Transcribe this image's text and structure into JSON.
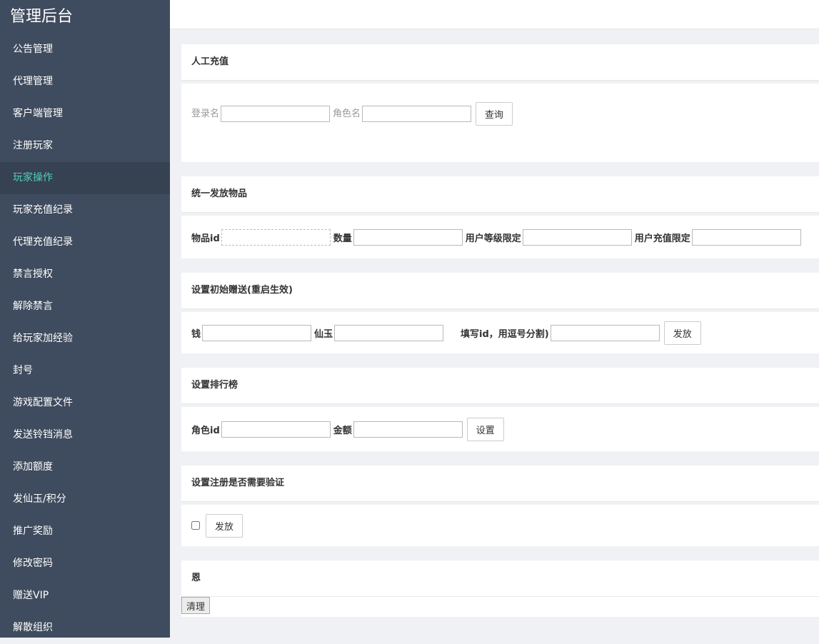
{
  "app": {
    "title": "管理后台"
  },
  "sidebar": {
    "items": [
      {
        "label": "公告管理"
      },
      {
        "label": "代理管理"
      },
      {
        "label": "客户端管理"
      },
      {
        "label": "注册玩家"
      },
      {
        "label": "玩家操作",
        "active": true
      },
      {
        "label": "玩家充值纪录"
      },
      {
        "label": "代理充值纪录"
      },
      {
        "label": "禁言授权"
      },
      {
        "label": "解除禁言"
      },
      {
        "label": "给玩家加经验"
      },
      {
        "label": "封号"
      },
      {
        "label": "游戏配置文件"
      },
      {
        "label": "发送铃铛消息"
      },
      {
        "label": "添加额度"
      },
      {
        "label": "发仙玉/积分"
      },
      {
        "label": "推广奖励"
      },
      {
        "label": "修改密码"
      },
      {
        "label": "赠送VIP"
      },
      {
        "label": "解散组织"
      }
    ]
  },
  "colors": {
    "sidebar_bg": "#3f4b5e",
    "active_bg": "#364152",
    "active_text": "#4fd1b4"
  },
  "panels": {
    "recharge": {
      "title": "人工充值",
      "login_label": "登录名",
      "role_label": "角色名",
      "query_button": "查询"
    },
    "items": {
      "title": "统一发放物品",
      "item_id_label": "物品id",
      "count_label": "数量",
      "level_label": "用户等级限定",
      "recharge_label": "用户充值限定"
    },
    "initial": {
      "title": "设置初始赠送(重启生效)",
      "money_label": "钱",
      "jade_label": "仙玉",
      "hint_label": "填写id，用逗号分割)",
      "send_button": "发放"
    },
    "rank": {
      "title": "设置排行榜",
      "role_id_label": "角色id",
      "amount_label": "金额",
      "set_button": "设置"
    },
    "verify": {
      "title": "设置注册是否需要验证",
      "send_button": "发放"
    },
    "misc": {
      "title": "恩",
      "clear_button": "清理"
    }
  }
}
